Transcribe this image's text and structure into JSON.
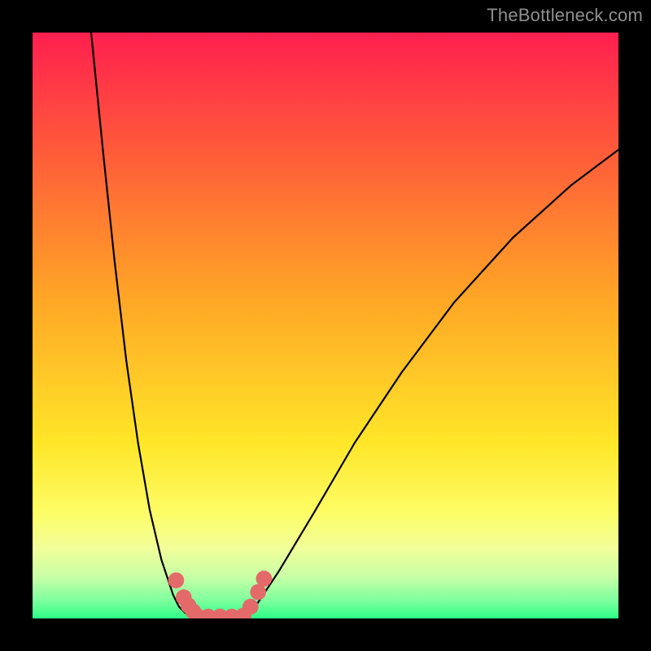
{
  "watermark": "TheBottleneck.com",
  "chart_data": {
    "type": "line",
    "title": "",
    "xlabel": "",
    "ylabel": "",
    "xlim": [
      0,
      100
    ],
    "ylim": [
      0,
      100
    ],
    "background_gradient": {
      "stops": [
        {
          "pos": 0.0,
          "color": "#ff1f4f"
        },
        {
          "pos": 0.2,
          "color": "#ff5a3a"
        },
        {
          "pos": 0.45,
          "color": "#ffa526"
        },
        {
          "pos": 0.7,
          "color": "#ffe628"
        },
        {
          "pos": 0.82,
          "color": "#fdfd66"
        },
        {
          "pos": 0.88,
          "color": "#f2ff9a"
        },
        {
          "pos": 0.93,
          "color": "#c6ffa6"
        },
        {
          "pos": 0.97,
          "color": "#7dff9e"
        },
        {
          "pos": 1.0,
          "color": "#2cff86"
        }
      ]
    },
    "series": [
      {
        "name": "left_branch",
        "x": [
          10.0,
          12.0,
          14.0,
          16.0,
          18.0,
          20.0,
          22.0,
          24.0,
          25.0,
          26.0,
          27.0,
          28.0
        ],
        "y": [
          100.0,
          80.0,
          61.0,
          44.0,
          30.0,
          18.5,
          10.0,
          4.0,
          2.0,
          1.0,
          0.4,
          0.0
        ]
      },
      {
        "name": "trough",
        "x": [
          28.0,
          30.0,
          32.0,
          34.0,
          36.0
        ],
        "y": [
          0.0,
          0.0,
          0.0,
          0.0,
          0.0
        ]
      },
      {
        "name": "right_branch",
        "x": [
          36.0,
          38.0,
          42.0,
          48.0,
          55.0,
          63.0,
          72.0,
          82.0,
          92.0,
          100.0
        ],
        "y": [
          0.0,
          2.0,
          8.0,
          18.0,
          30.0,
          42.0,
          54.0,
          65.0,
          74.0,
          80.0
        ]
      }
    ],
    "markers": [
      {
        "x": 24.5,
        "y": 6.5,
        "r": 0.9
      },
      {
        "x": 25.8,
        "y": 3.6,
        "r": 0.9
      },
      {
        "x": 26.6,
        "y": 2.2,
        "r": 0.9
      },
      {
        "x": 27.4,
        "y": 1.2,
        "r": 0.9
      },
      {
        "x": 28.0,
        "y": 0.5,
        "r": 0.9
      },
      {
        "x": 30.0,
        "y": 0.3,
        "r": 0.9
      },
      {
        "x": 32.0,
        "y": 0.3,
        "r": 0.9
      },
      {
        "x": 34.0,
        "y": 0.3,
        "r": 0.9
      },
      {
        "x": 36.0,
        "y": 0.5,
        "r": 0.9
      },
      {
        "x": 37.2,
        "y": 2.0,
        "r": 0.9
      },
      {
        "x": 38.5,
        "y": 4.5,
        "r": 0.9
      },
      {
        "x": 39.5,
        "y": 6.8,
        "r": 0.9
      }
    ],
    "marker_color": "#e46a6a",
    "line_color": "#000000"
  }
}
